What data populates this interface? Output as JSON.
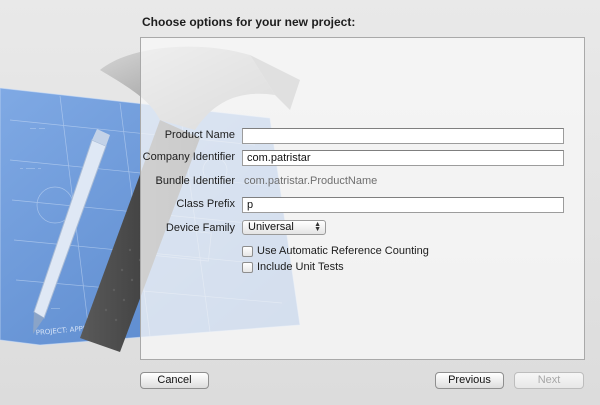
{
  "heading": "Choose options for your new project:",
  "form": {
    "product_name": {
      "label": "Product Name",
      "value": ""
    },
    "company_identifier": {
      "label": "Company Identifier",
      "value": "com.patristar"
    },
    "bundle_identifier": {
      "label": "Bundle Identifier",
      "value": "com.patristar.ProductName"
    },
    "class_prefix": {
      "label": "Class Prefix",
      "value": "p"
    },
    "device_family": {
      "label": "Device Family",
      "selected": "Universal"
    }
  },
  "options": {
    "arc": {
      "label": "Use Automatic Reference Counting",
      "checked": false
    },
    "unit_tests": {
      "label": "Include Unit Tests",
      "checked": false
    }
  },
  "buttons": {
    "cancel": "Cancel",
    "previous": "Previous",
    "next": "Next"
  },
  "artwork": {
    "blueprint_text": "PROJECT: APPLICATION APP",
    "icons": [
      "hammer-icon",
      "blueprint-icon",
      "pencil-icon"
    ]
  },
  "colors": {
    "blueprint": "#5d8fd6",
    "hammer_handle": "#4a4a4a",
    "hammer_head": "#9a9a9a"
  }
}
